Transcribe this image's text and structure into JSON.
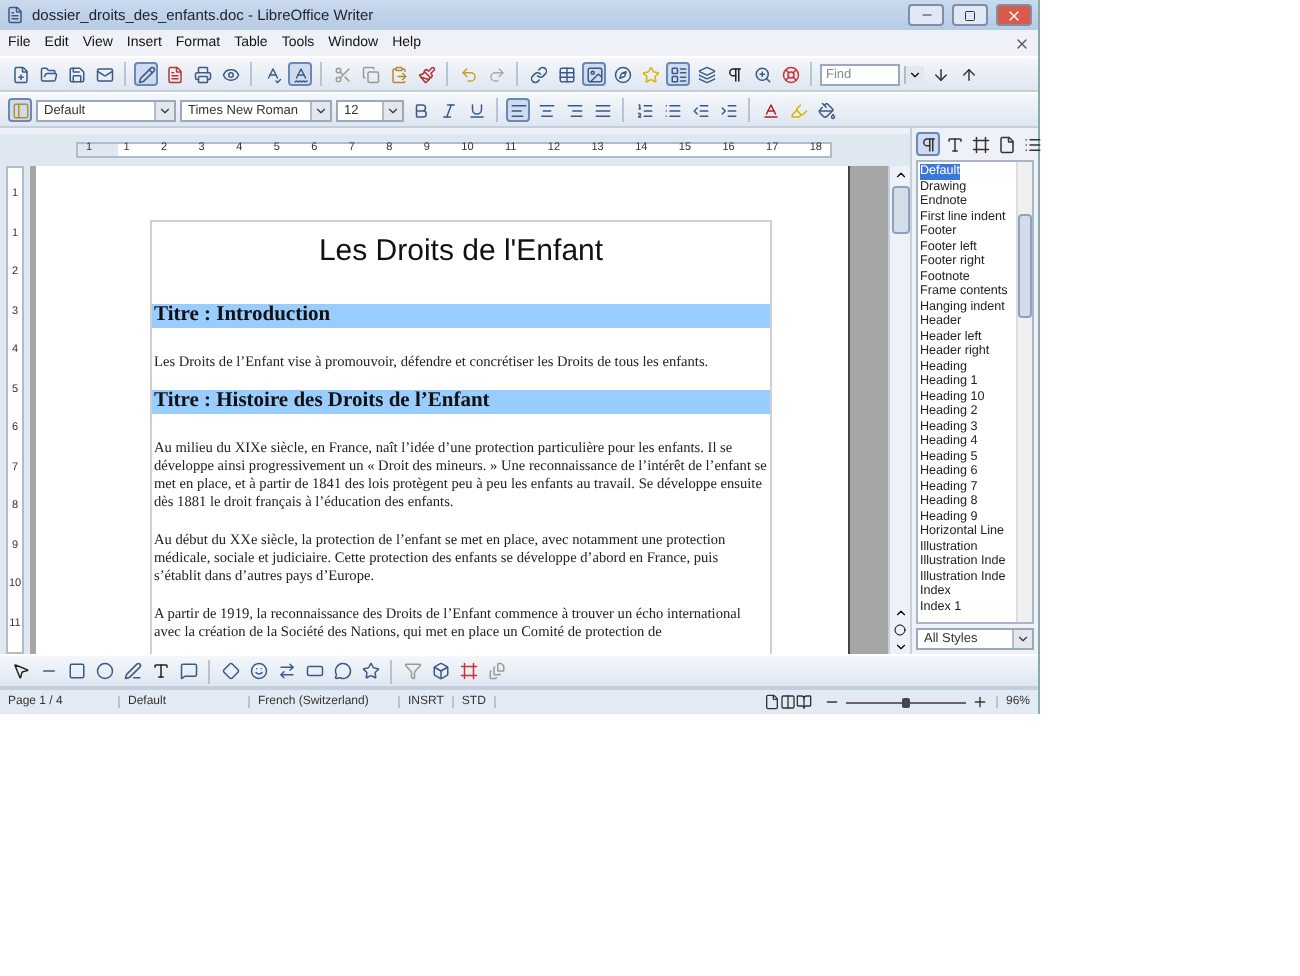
{
  "window": {
    "title": "dossier_droits_des_enfants.doc - LibreOffice Writer"
  },
  "menu": [
    "File",
    "Edit",
    "View",
    "Insert",
    "Format",
    "Table",
    "Tools",
    "Window",
    "Help"
  ],
  "toolbar": {
    "find": {
      "placeholder": "Find"
    }
  },
  "format_bar": {
    "style": "Default",
    "font": "Times New Roman",
    "size": "12"
  },
  "ruler": {
    "labels": [
      "1",
      "1",
      "2",
      "3",
      "4",
      "5",
      "6",
      "7",
      "8",
      "9",
      "10",
      "11",
      "12",
      "13",
      "14",
      "15",
      "16",
      "17",
      "18"
    ]
  },
  "vertical_ruler": {
    "labels": [
      "1",
      "1",
      "2",
      "3",
      "4",
      "5",
      "6",
      "7",
      "8",
      "9",
      "10",
      "11"
    ]
  },
  "document": {
    "title": "Les Droits de l'Enfant",
    "blocks": [
      {
        "kind": "heading",
        "text": "Titre : Introduction"
      },
      {
        "kind": "paragraph",
        "text": "Les Droits de l’Enfant vise à promouvoir, défendre et concrétiser les Droits de tous les enfants."
      },
      {
        "kind": "heading",
        "text": "Titre : Histoire des Droits de l’Enfant"
      },
      {
        "kind": "paragraph",
        "text": "Au milieu du XIXe siècle, en France, naît l’idée d’une protection particulière pour les enfants. Il se développe ainsi progressivement un « Droit des mineurs. » Une reconnaissance de l’intérêt de l’enfant se met en place, et à partir de 1841 des lois protègent peu à peu les enfants au travail. Se développe ensuite dès 1881 le droit français à l’éducation des enfants."
      },
      {
        "kind": "paragraph",
        "text": "Au début du XXe siècle, la protection de l’enfant se met en place, avec notamment une protection médicale, sociale et judiciaire. Cette protection des enfants se développe d’abord en France, puis s’établit dans d’autres pays d’Europe."
      },
      {
        "kind": "paragraph",
        "text": "A partir de 1919, la reconnaissance des Droits de l’Enfant commence à trouver un écho international avec la création de la Société des Nations, qui met en place un Comité de protection de"
      }
    ]
  },
  "styles_panel": {
    "items": [
      {
        "label": "Default",
        "selected": true
      },
      {
        "label": "Drawing",
        "selected": false
      },
      {
        "label": "Endnote",
        "selected": false
      },
      {
        "label": "First line indent",
        "selected": false
      },
      {
        "label": "Footer",
        "selected": false
      },
      {
        "label": "Footer left",
        "selected": false
      },
      {
        "label": "Footer right",
        "selected": false
      },
      {
        "label": "Footnote",
        "selected": false
      },
      {
        "label": "Frame contents",
        "selected": false
      },
      {
        "label": "Hanging indent",
        "selected": false
      },
      {
        "label": "Header",
        "selected": false
      },
      {
        "label": "Header left",
        "selected": false
      },
      {
        "label": "Header right",
        "selected": false
      },
      {
        "label": "Heading",
        "selected": false
      },
      {
        "label": "Heading 1",
        "selected": false
      },
      {
        "label": "Heading 10",
        "selected": false
      },
      {
        "label": "Heading 2",
        "selected": false
      },
      {
        "label": "Heading 3",
        "selected": false
      },
      {
        "label": "Heading 4",
        "selected": false
      },
      {
        "label": "Heading 5",
        "selected": false
      },
      {
        "label": "Heading 6",
        "selected": false
      },
      {
        "label": "Heading 7",
        "selected": false
      },
      {
        "label": "Heading 8",
        "selected": false
      },
      {
        "label": "Heading 9",
        "selected": false
      },
      {
        "label": "Horizontal Line",
        "selected": false
      },
      {
        "label": "Illustration",
        "selected": false
      },
      {
        "label": "Illustration Inde",
        "selected": false
      },
      {
        "label": "Illustration Inde",
        "selected": false
      },
      {
        "label": "Index",
        "selected": false
      },
      {
        "label": "Index 1",
        "selected": false
      }
    ],
    "filter": "All Styles"
  },
  "status_bar": {
    "page": "Page 1 / 4",
    "style": "Default",
    "language": "French (Switzerland)",
    "insert_mode": "INSRT",
    "selection_mode": "STD",
    "zoom": {
      "level": 0.5,
      "reading": "96%"
    }
  }
}
